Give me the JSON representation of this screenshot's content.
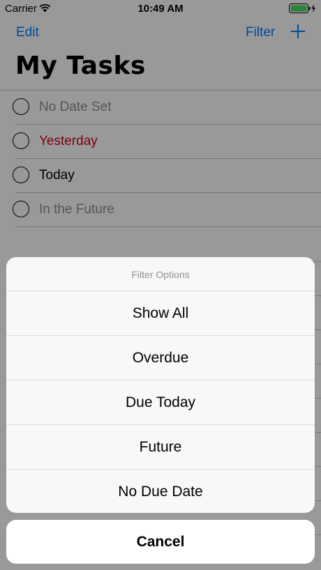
{
  "status_bar": {
    "carrier": "Carrier",
    "time": "10:49 AM",
    "battery_color": "#4cd964"
  },
  "nav": {
    "edit_label": "Edit",
    "filter_label": "Filter",
    "add_icon": "plus-icon",
    "tint_color": "#007aff"
  },
  "page": {
    "title": "My Tasks"
  },
  "tasks": [
    {
      "title": "No Date Set",
      "status": "no-date"
    },
    {
      "title": "Yesterday",
      "status": "overdue",
      "color": "#d0021b"
    },
    {
      "title": "Today",
      "status": "today"
    },
    {
      "title": "In the Future",
      "status": "future"
    }
  ],
  "action_sheet": {
    "title": "Filter Options",
    "options": [
      "Show All",
      "Overdue",
      "Due Today",
      "Future",
      "No Due Date"
    ],
    "cancel_label": "Cancel"
  }
}
